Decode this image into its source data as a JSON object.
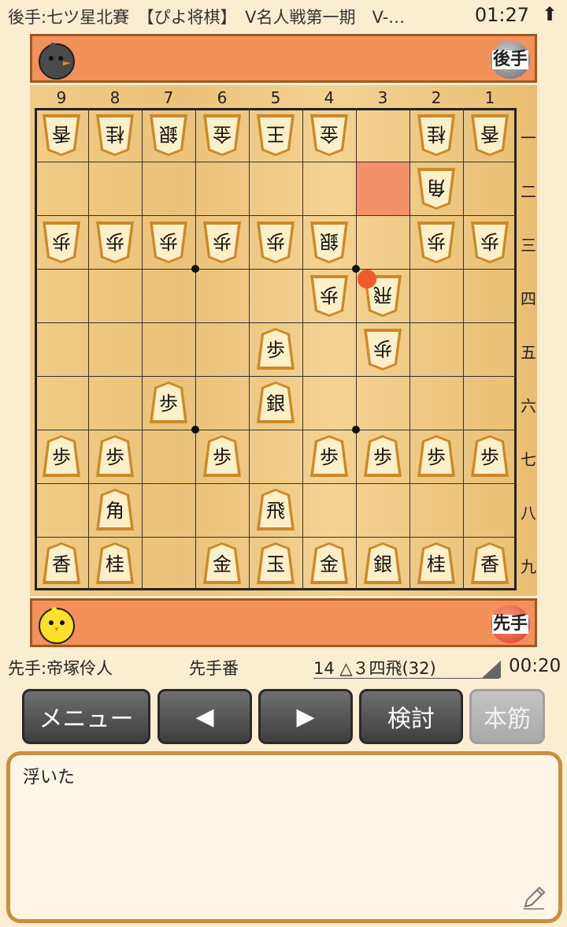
{
  "status_bar": {
    "title": "後手:七ツ星北賽　【ぴよ将棋】　V名人戦第一期　V-…",
    "time": "01:27",
    "arrow": "⬆"
  },
  "gote_hand": {
    "badge": "後手",
    "avatar": "gray-chick-icon"
  },
  "sente_hand": {
    "badge": "先手",
    "avatar": "yellow-chick-icon"
  },
  "board": {
    "files": [
      "9",
      "8",
      "7",
      "6",
      "5",
      "4",
      "3",
      "2",
      "1"
    ],
    "ranks": [
      "一",
      "二",
      "三",
      "四",
      "五",
      "六",
      "七",
      "八",
      "九"
    ],
    "highlight_square": "3二",
    "last_move_square": "3四",
    "pieces": [
      {
        "label": "香",
        "side": "gote",
        "file": 9,
        "rank": 1
      },
      {
        "label": "桂",
        "side": "gote",
        "file": 8,
        "rank": 1
      },
      {
        "label": "銀",
        "side": "gote",
        "file": 7,
        "rank": 1
      },
      {
        "label": "金",
        "side": "gote",
        "file": 6,
        "rank": 1
      },
      {
        "label": "王",
        "side": "gote",
        "file": 5,
        "rank": 1
      },
      {
        "label": "金",
        "side": "gote",
        "file": 4,
        "rank": 1
      },
      {
        "label": "桂",
        "side": "gote",
        "file": 2,
        "rank": 1
      },
      {
        "label": "香",
        "side": "gote",
        "file": 1,
        "rank": 1
      },
      {
        "label": "角",
        "side": "gote",
        "file": 2,
        "rank": 2
      },
      {
        "label": "歩",
        "side": "gote",
        "file": 9,
        "rank": 3
      },
      {
        "label": "歩",
        "side": "gote",
        "file": 8,
        "rank": 3
      },
      {
        "label": "歩",
        "side": "gote",
        "file": 7,
        "rank": 3
      },
      {
        "label": "歩",
        "side": "gote",
        "file": 6,
        "rank": 3
      },
      {
        "label": "歩",
        "side": "gote",
        "file": 5,
        "rank": 3
      },
      {
        "label": "銀",
        "side": "gote",
        "file": 4,
        "rank": 3
      },
      {
        "label": "歩",
        "side": "gote",
        "file": 2,
        "rank": 3
      },
      {
        "label": "歩",
        "side": "gote",
        "file": 1,
        "rank": 3
      },
      {
        "label": "歩",
        "side": "gote",
        "file": 4,
        "rank": 4
      },
      {
        "label": "飛",
        "side": "gote",
        "file": 3,
        "rank": 4
      },
      {
        "label": "歩",
        "side": "gote",
        "file": 3,
        "rank": 5
      },
      {
        "label": "歩",
        "side": "sente",
        "file": 5,
        "rank": 5
      },
      {
        "label": "歩",
        "side": "sente",
        "file": 7,
        "rank": 6
      },
      {
        "label": "銀",
        "side": "sente",
        "file": 5,
        "rank": 6
      },
      {
        "label": "歩",
        "side": "sente",
        "file": 9,
        "rank": 7
      },
      {
        "label": "歩",
        "side": "sente",
        "file": 8,
        "rank": 7
      },
      {
        "label": "歩",
        "side": "sente",
        "file": 6,
        "rank": 7
      },
      {
        "label": "歩",
        "side": "sente",
        "file": 4,
        "rank": 7
      },
      {
        "label": "歩",
        "side": "sente",
        "file": 3,
        "rank": 7
      },
      {
        "label": "歩",
        "side": "sente",
        "file": 2,
        "rank": 7
      },
      {
        "label": "歩",
        "side": "sente",
        "file": 1,
        "rank": 7
      },
      {
        "label": "角",
        "side": "sente",
        "file": 8,
        "rank": 8
      },
      {
        "label": "飛",
        "side": "sente",
        "file": 5,
        "rank": 8
      },
      {
        "label": "香",
        "side": "sente",
        "file": 9,
        "rank": 9
      },
      {
        "label": "桂",
        "side": "sente",
        "file": 8,
        "rank": 9
      },
      {
        "label": "金",
        "side": "sente",
        "file": 6,
        "rank": 9
      },
      {
        "label": "玉",
        "side": "sente",
        "file": 5,
        "rank": 9
      },
      {
        "label": "金",
        "side": "sente",
        "file": 4,
        "rank": 9
      },
      {
        "label": "銀",
        "side": "sente",
        "file": 3,
        "rank": 9
      },
      {
        "label": "桂",
        "side": "sente",
        "file": 2,
        "rank": 9
      },
      {
        "label": "香",
        "side": "sente",
        "file": 1,
        "rank": 9
      }
    ]
  },
  "info": {
    "player": "先手:帝塚伶人",
    "turn": "先手番",
    "move": "14 △３四飛(32)",
    "clock": "00:20"
  },
  "buttons": {
    "menu": "メニュー",
    "prev": "◀",
    "next": "▶",
    "analyze": "検討",
    "mainline": "本筋"
  },
  "comment": {
    "text": "浮いた",
    "edit_icon": "pencil-icon"
  },
  "colors": {
    "hand_bar": "#f2915a",
    "board": "#ebc27a",
    "highlight": "#f2916a",
    "last_move_dot": "#f05a28",
    "button": "#4a4a4a",
    "comment_border": "#c8903c"
  }
}
